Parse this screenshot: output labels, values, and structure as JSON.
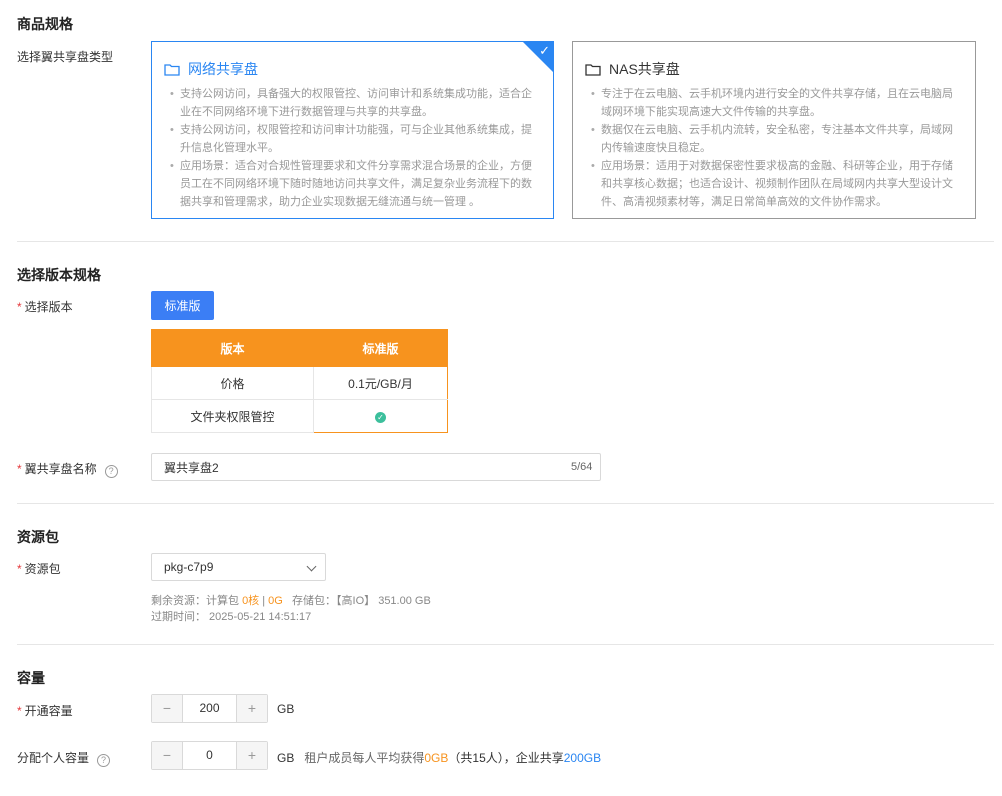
{
  "spec": {
    "title": "商品规格",
    "type_label": "选择翼共享盘类型",
    "cards": [
      {
        "title": "网络共享盘",
        "selected": true,
        "bullets": [
          "支持公网访问，具备强大的权限管控、访问审计和系统集成功能，适合企业在不同网络环境下进行数据管理与共享的共享盘。",
          "支持公网访问，权限管控和访问审计功能强，可与企业其他系统集成，提升信息化管理水平。",
          "应用场景：适合对合规性管理要求和文件分享需求混合场景的企业，方便员工在不同网络环境下随时随地访问共享文件，满足复杂业务流程下的数据共享和管理需求，助力企业实现数据无缝流通与统一管理 。"
        ]
      },
      {
        "title": "NAS共享盘",
        "selected": false,
        "bullets": [
          "专注于在云电脑、云手机环境内进行安全的文件共享存储，且在云电脑局域网环境下能实现高速大文件传输的共享盘。",
          "数据仅在云电脑、云手机内流转，安全私密，专注基本文件共享，局域网内传输速度快且稳定。",
          "应用场景：适用于对数据保密性要求极高的金融、科研等企业，用于存储和共享核心数据；也适合设计、视频制作团队在局域网内共享大型设计文件、高清视频素材等，满足日常简单高效的文件协作需求。"
        ]
      }
    ]
  },
  "version": {
    "title": "选择版本规格",
    "select_label": "选择版本",
    "button": "标准版",
    "table": {
      "headers": [
        "版本",
        "标准版"
      ],
      "rows": [
        [
          "价格",
          "0.1元/GB/月"
        ],
        [
          "文件夹权限管控",
          ""
        ]
      ]
    },
    "name_label": "翼共享盘名称",
    "name_value": "翼共享盘2",
    "name_counter": "5/64"
  },
  "resource": {
    "title": "资源包",
    "label": "资源包",
    "selected": "pkg-c7p9",
    "remain_prefix": "剩余资源：计算包 ",
    "compute_cores": "0核",
    "sep": " | ",
    "compute_g": "0G",
    "storage": "   存储包：【高IO】 351.00 GB",
    "expire": "过期时间： 2025-05-21 14:51:17"
  },
  "capacity": {
    "title": "容量",
    "open_label": "开通容量",
    "open_value": "200",
    "unit": "GB",
    "personal_label": "分配个人容量",
    "personal_value": "0",
    "note_prefix": "租户成员每人平均获得",
    "note_avg": "0GB",
    "note_mid": "（共15人），企业共享",
    "note_shared": "200GB"
  },
  "colors": {
    "accent": "#2a86f2",
    "orange": "#f7931e",
    "required": "#e4393c"
  }
}
